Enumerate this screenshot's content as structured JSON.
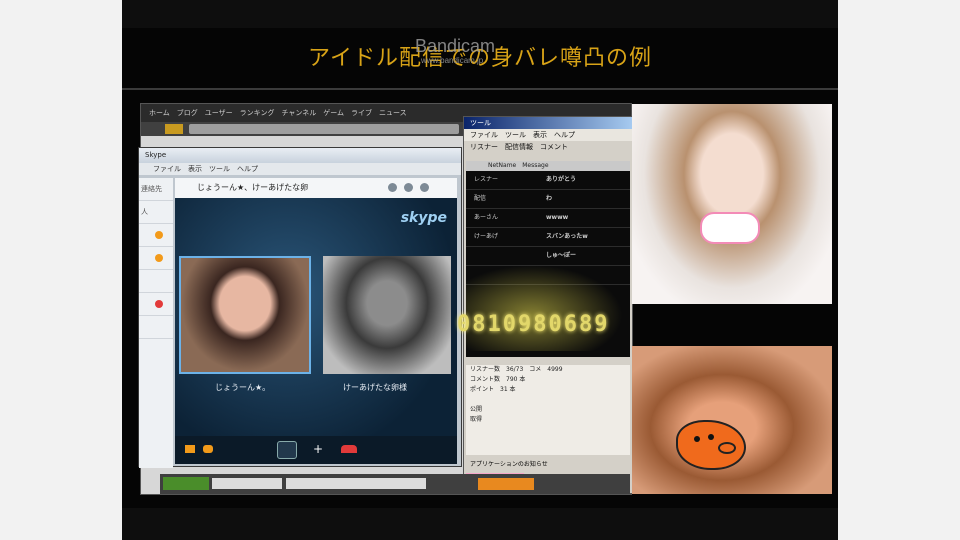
{
  "slide": {
    "title": "アイドル配信での身バレ噂凸の例",
    "watermark": "Bandicam",
    "watermark_sub": "www.bandicam.jp"
  },
  "browser": {
    "top_text": "ホーム　ブログ　ユーザー　ランキング　チャンネル　ゲーム　ライブ　ニュース"
  },
  "skype": {
    "title": "Skype",
    "menu": "ファイル　表示　ツール　ヘルプ",
    "call_title": "じょうーん★、けーあげたな卵",
    "logo": "skype",
    "caller_left": "じょうーん★。",
    "caller_right": "けーあげたな卵様",
    "sidebar": [
      "連絡先",
      "人",
      "",
      "",
      "",
      "",
      "人",
      "",
      "",
      ""
    ]
  },
  "tool": {
    "title": "ツール",
    "menu": "ファイル　ツール　表示　ヘルプ",
    "tabs": "リスナー　配信情報　コメント",
    "list_header": "NetName　Message",
    "rows": [
      {
        "name": "レスナー",
        "msg": "ありがとう"
      },
      {
        "name": "配信",
        "msg": "わ"
      },
      {
        "name": "あーさん",
        "msg": "wwww"
      },
      {
        "name": "けーあげ",
        "msg": "スバンあったw"
      },
      {
        "name": "",
        "msg": "しゅ～ぽー"
      },
      {
        "name": "",
        "msg": ""
      }
    ],
    "big_number": "0810980689",
    "panel": [
      "リスナー数　36/73　コメ　4999",
      "コメント数　790 本",
      "ポイント　31 本",
      "",
      "公開　　　",
      "取得"
    ],
    "bottom_text": "アプリケーションのお知らせ"
  },
  "colors": {
    "title": "#d8a317",
    "slide_bg": "#050505",
    "skype_call_bg": "#0c2236",
    "end_call": "#e23a3a"
  }
}
